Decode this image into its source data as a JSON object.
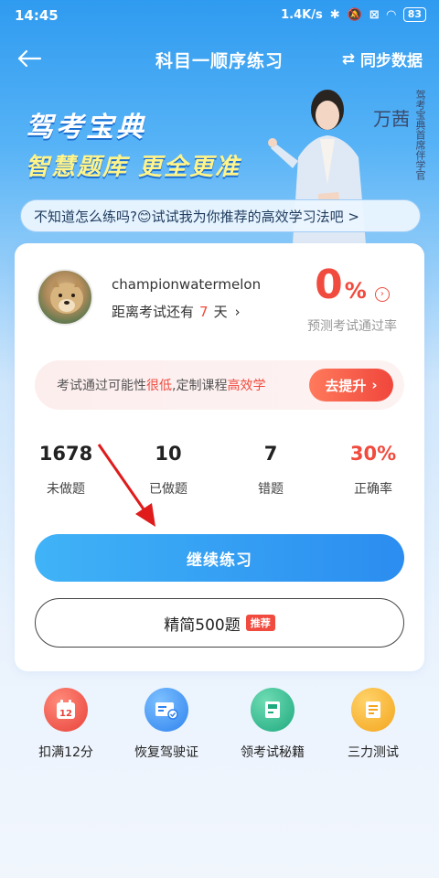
{
  "status_bar": {
    "time": "14:45",
    "network_speed": "1.4K/s",
    "battery": "83"
  },
  "nav": {
    "title": "科目一顺序练习",
    "sync_label": "同步数据"
  },
  "banner": {
    "title": "驾考宝典",
    "slogan": "智慧题库 更全更准",
    "spokesperson_name": "万茜",
    "spokesperson_role": "驾考宝典首席伴学官"
  },
  "tip": {
    "text": "不知道怎么练吗?😊试试我为你推荐的高效学习法吧 >"
  },
  "profile": {
    "username": "championwatermelon",
    "exam_prefix": "距离考试还有",
    "exam_days": "7",
    "exam_suffix": "天",
    "pass_rate_value": "0",
    "pass_rate_unit": "%",
    "pass_rate_label": "预测考试通过率"
  },
  "promo": {
    "text_before": "考试通过可能性",
    "text_highlight1": "很低",
    "text_middle": ",定制课程",
    "text_highlight2": "高效学",
    "button_label": "去提升"
  },
  "stats": [
    {
      "value": "1678",
      "label": "未做题",
      "color": "default"
    },
    {
      "value": "10",
      "label": "已做题",
      "color": "default"
    },
    {
      "value": "7",
      "label": "错题",
      "color": "default"
    },
    {
      "value": "30%",
      "label": "正确率",
      "color": "red"
    }
  ],
  "actions": {
    "continue_label": "继续练习",
    "simplified_label": "精简500题",
    "simplified_tag": "推荐"
  },
  "tools": [
    {
      "label": "扣满12分",
      "icon": "calendar-12-icon",
      "color": "#f0584a"
    },
    {
      "label": "恢复驾驶证",
      "icon": "license-card-icon",
      "color": "#3d94f2"
    },
    {
      "label": "领考试秘籍",
      "icon": "book-icon",
      "color": "#27b48a"
    },
    {
      "label": "三力测试",
      "icon": "document-icon",
      "color": "#f5a623"
    }
  ],
  "colors": {
    "accent_blue": "#2b8df0",
    "accent_red": "#f04b3e",
    "header_blue": "#2f9bf0"
  }
}
